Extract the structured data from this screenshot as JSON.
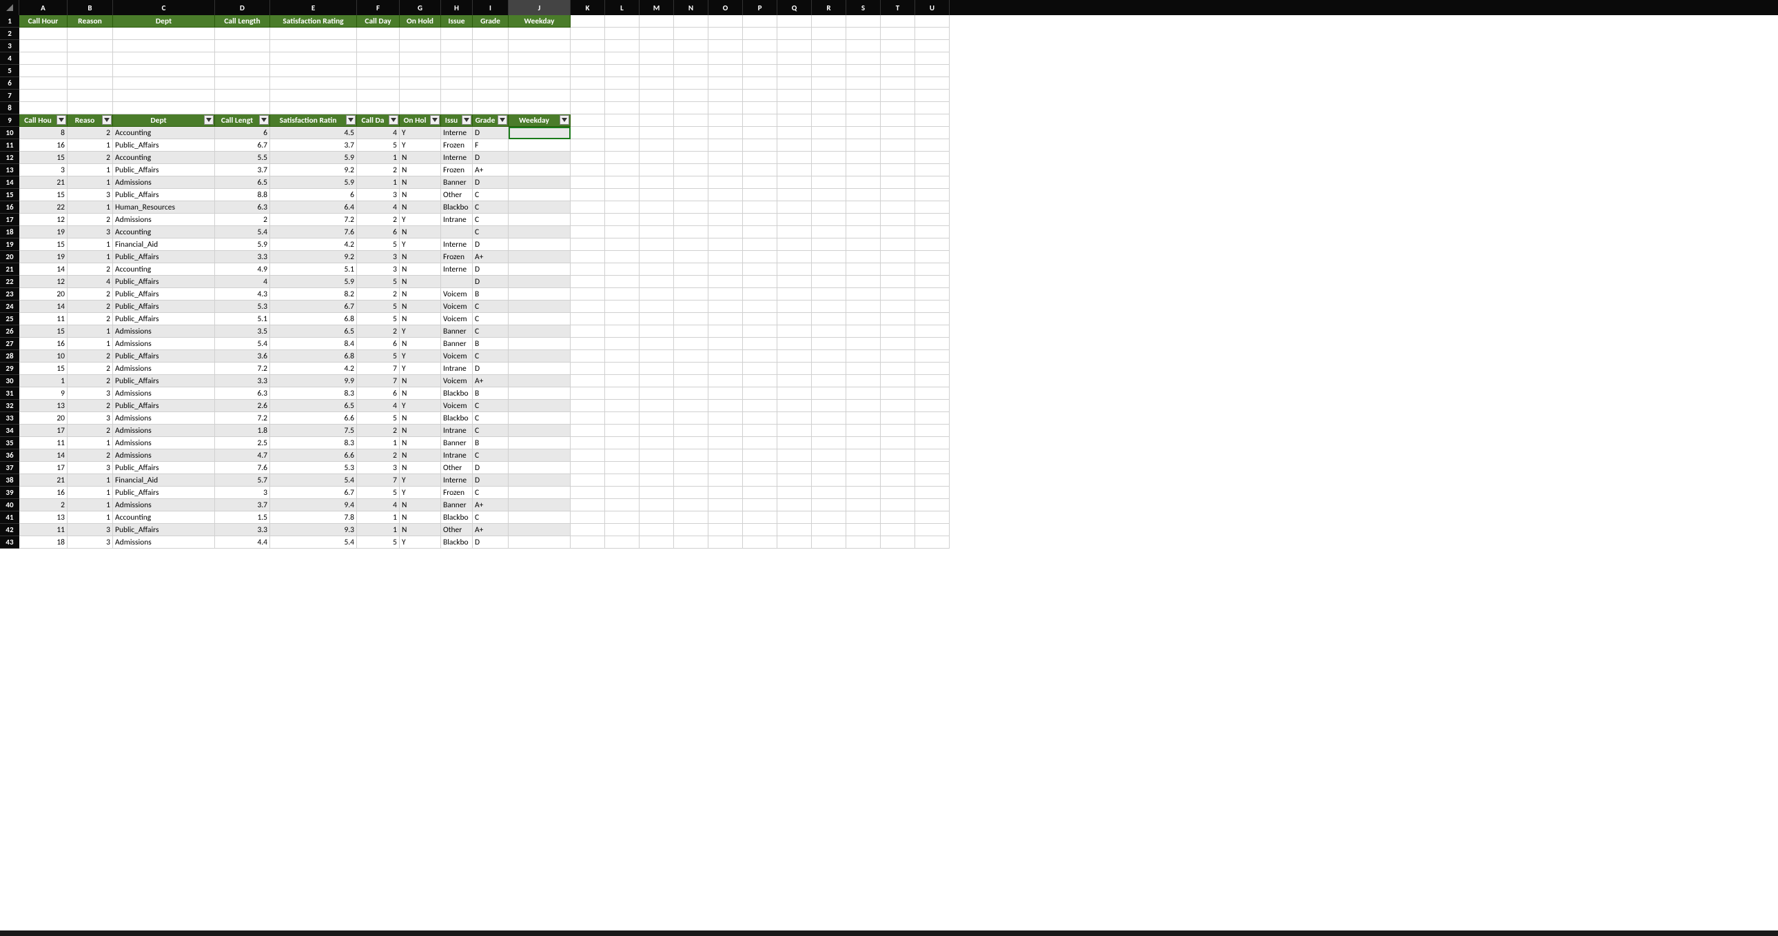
{
  "columns": [
    {
      "letter": "A",
      "width": 70
    },
    {
      "letter": "B",
      "width": 66
    },
    {
      "letter": "C",
      "width": 148
    },
    {
      "letter": "D",
      "width": 80
    },
    {
      "letter": "E",
      "width": 126
    },
    {
      "letter": "F",
      "width": 62
    },
    {
      "letter": "G",
      "width": 60
    },
    {
      "letter": "H",
      "width": 46
    },
    {
      "letter": "I",
      "width": 52
    },
    {
      "letter": "J",
      "width": 90
    },
    {
      "letter": "K",
      "width": 50
    },
    {
      "letter": "L",
      "width": 50
    },
    {
      "letter": "M",
      "width": 50
    },
    {
      "letter": "N",
      "width": 50
    },
    {
      "letter": "O",
      "width": 50
    },
    {
      "letter": "P",
      "width": 50
    },
    {
      "letter": "Q",
      "width": 50
    },
    {
      "letter": "R",
      "width": 50
    },
    {
      "letter": "S",
      "width": 50
    },
    {
      "letter": "T",
      "width": 50
    },
    {
      "letter": "U",
      "width": 50
    }
  ],
  "selected_column": "J",
  "selected_cell": {
    "row": 10,
    "col": "J"
  },
  "header_row1": [
    "Call Hour",
    "Reason",
    "Dept",
    "Call Length",
    "Satisfaction Rating",
    "Call Day",
    "On Hold",
    "Issue",
    "Grade",
    "Weekday"
  ],
  "filter_row9": [
    "Call Hou",
    "Reaso",
    "Dept",
    "Call Lengt",
    "Satisfaction Ratin",
    "Call Da",
    "On Hol",
    "Issu",
    "Grade",
    "Weekday"
  ],
  "data_start_row": 10,
  "data": [
    [
      8,
      2,
      "Accounting",
      6,
      4.5,
      4,
      "Y",
      "Interne",
      "D",
      ""
    ],
    [
      16,
      1,
      "Public_Affairs",
      6.7,
      3.7,
      5,
      "Y",
      "Frozen",
      "F",
      ""
    ],
    [
      15,
      2,
      "Accounting",
      5.5,
      5.9,
      1,
      "N",
      "Interne",
      "D",
      ""
    ],
    [
      3,
      1,
      "Public_Affairs",
      3.7,
      9.2,
      2,
      "N",
      "Frozen",
      "A+",
      ""
    ],
    [
      21,
      1,
      "Admissions",
      6.5,
      5.9,
      1,
      "N",
      "Banner",
      "D",
      ""
    ],
    [
      15,
      3,
      "Public_Affairs",
      8.8,
      6,
      3,
      "N",
      "Other",
      "C",
      ""
    ],
    [
      22,
      1,
      "Human_Resources",
      6.3,
      6.4,
      4,
      "N",
      "Blackbo",
      "C",
      ""
    ],
    [
      12,
      2,
      "Admissions",
      2,
      7.2,
      2,
      "Y",
      "Intrane",
      "C",
      ""
    ],
    [
      19,
      3,
      "Accounting",
      5.4,
      7.6,
      6,
      "N",
      "",
      "C",
      ""
    ],
    [
      15,
      1,
      "Financial_Aid",
      5.9,
      4.2,
      5,
      "Y",
      "Interne",
      "D",
      ""
    ],
    [
      19,
      1,
      "Public_Affairs",
      3.3,
      9.2,
      3,
      "N",
      "Frozen",
      "A+",
      ""
    ],
    [
      14,
      2,
      "Accounting",
      4.9,
      5.1,
      3,
      "N",
      "Interne",
      "D",
      ""
    ],
    [
      12,
      4,
      "Public_Affairs",
      4,
      5.9,
      5,
      "N",
      "",
      "D",
      ""
    ],
    [
      20,
      2,
      "Public_Affairs",
      4.3,
      8.2,
      2,
      "N",
      "Voicem",
      "B",
      ""
    ],
    [
      14,
      2,
      "Public_Affairs",
      5.3,
      6.7,
      5,
      "N",
      "Voicem",
      "C",
      ""
    ],
    [
      11,
      2,
      "Public_Affairs",
      5.1,
      6.8,
      5,
      "N",
      "Voicem",
      "C",
      ""
    ],
    [
      15,
      1,
      "Admissions",
      3.5,
      6.5,
      2,
      "Y",
      "Banner",
      "C",
      ""
    ],
    [
      16,
      1,
      "Admissions",
      5.4,
      8.4,
      6,
      "N",
      "Banner",
      "B",
      ""
    ],
    [
      10,
      2,
      "Public_Affairs",
      3.6,
      6.8,
      5,
      "Y",
      "Voicem",
      "C",
      ""
    ],
    [
      15,
      2,
      "Admissions",
      7.2,
      4.2,
      7,
      "Y",
      "Intrane",
      "D",
      ""
    ],
    [
      1,
      2,
      "Public_Affairs",
      3.3,
      9.9,
      7,
      "N",
      "Voicem",
      "A+",
      ""
    ],
    [
      9,
      3,
      "Admissions",
      6.3,
      8.3,
      6,
      "N",
      "Blackbo",
      "B",
      ""
    ],
    [
      13,
      2,
      "Public_Affairs",
      2.6,
      6.5,
      4,
      "Y",
      "Voicem",
      "C",
      ""
    ],
    [
      20,
      3,
      "Admissions",
      7.2,
      6.6,
      5,
      "N",
      "Blackbo",
      "C",
      ""
    ],
    [
      17,
      2,
      "Admissions",
      1.8,
      7.5,
      2,
      "N",
      "Intrane",
      "C",
      ""
    ],
    [
      11,
      1,
      "Admissions",
      2.5,
      8.3,
      1,
      "N",
      "Banner",
      "B",
      ""
    ],
    [
      14,
      2,
      "Admissions",
      4.7,
      6.6,
      2,
      "N",
      "Intrane",
      "C",
      ""
    ],
    [
      17,
      3,
      "Public_Affairs",
      7.6,
      5.3,
      3,
      "N",
      "Other",
      "D",
      ""
    ],
    [
      21,
      1,
      "Financial_Aid",
      5.7,
      5.4,
      7,
      "Y",
      "Interne",
      "D",
      ""
    ],
    [
      16,
      1,
      "Public_Affairs",
      3,
      6.7,
      5,
      "Y",
      "Frozen",
      "C",
      ""
    ],
    [
      2,
      1,
      "Admissions",
      3.7,
      9.4,
      4,
      "N",
      "Banner",
      "A+",
      ""
    ],
    [
      13,
      1,
      "Accounting",
      1.5,
      7.8,
      1,
      "N",
      "Blackbo",
      "C",
      ""
    ],
    [
      11,
      3,
      "Public_Affairs",
      3.3,
      9.3,
      1,
      "N",
      "Other",
      "A+",
      ""
    ],
    [
      18,
      3,
      "Admissions",
      4.4,
      5.4,
      5,
      "Y",
      "Blackbo",
      "D",
      ""
    ]
  ],
  "blank_rows_before_filter": [
    2,
    3,
    4,
    5,
    6,
    7,
    8
  ],
  "numeric_cols": [
    0,
    1,
    3,
    4,
    5
  ]
}
